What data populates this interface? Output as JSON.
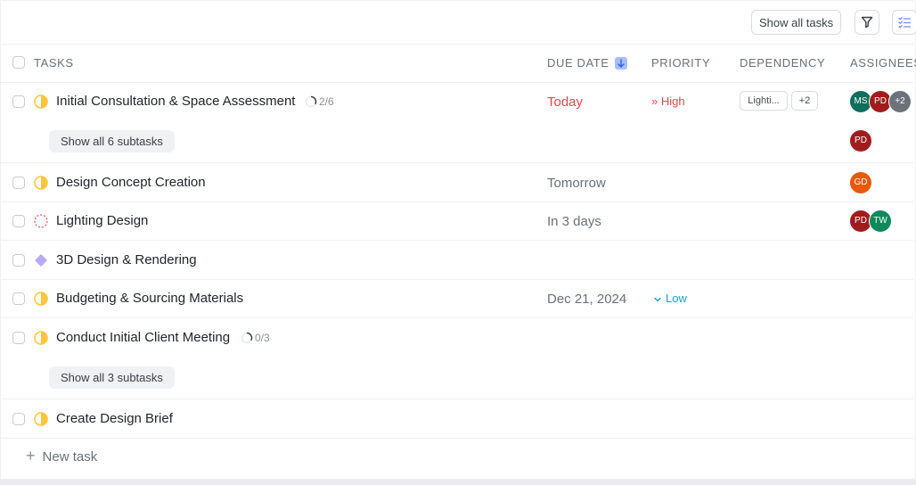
{
  "toolbar": {
    "show_all_tasks": "Show all tasks"
  },
  "columns": {
    "tasks": "TASKS",
    "due_date": "DUE DATE",
    "priority": "PRIORITY",
    "dependency": "DEPENDENCY",
    "assignees": "ASSIGNEES"
  },
  "tasks": [
    {
      "name": "Initial Consultation & Space Assessment",
      "progress": "2/6",
      "due": "Today",
      "priority": "High",
      "dependency_chip": "Lighti...",
      "dependency_more": "+2",
      "assignees": [
        "MS",
        "PD"
      ],
      "assignees_more": "+2",
      "subtasks_label": "Show all 6 subtasks",
      "subtask_assignee": "PD"
    },
    {
      "name": "Design Concept Creation",
      "due": "Tomorrow",
      "assignees": [
        "GD"
      ]
    },
    {
      "name": "Lighting Design",
      "due": "In 3 days",
      "assignees": [
        "PD",
        "TW"
      ]
    },
    {
      "name": "3D Design & Rendering"
    },
    {
      "name": "Budgeting & Sourcing Materials",
      "due": "Dec 21, 2024",
      "priority": "Low"
    },
    {
      "name": "Conduct Initial Client Meeting",
      "progress": "0/3",
      "subtasks_label": "Show all 3 subtasks"
    },
    {
      "name": "Create Design Brief"
    }
  ],
  "new_task": "New task",
  "colors": {
    "accent": "#6b8ff0",
    "high": "#e5484d",
    "low": "#1a9fd6",
    "status_yellow": "#ffc53d"
  }
}
